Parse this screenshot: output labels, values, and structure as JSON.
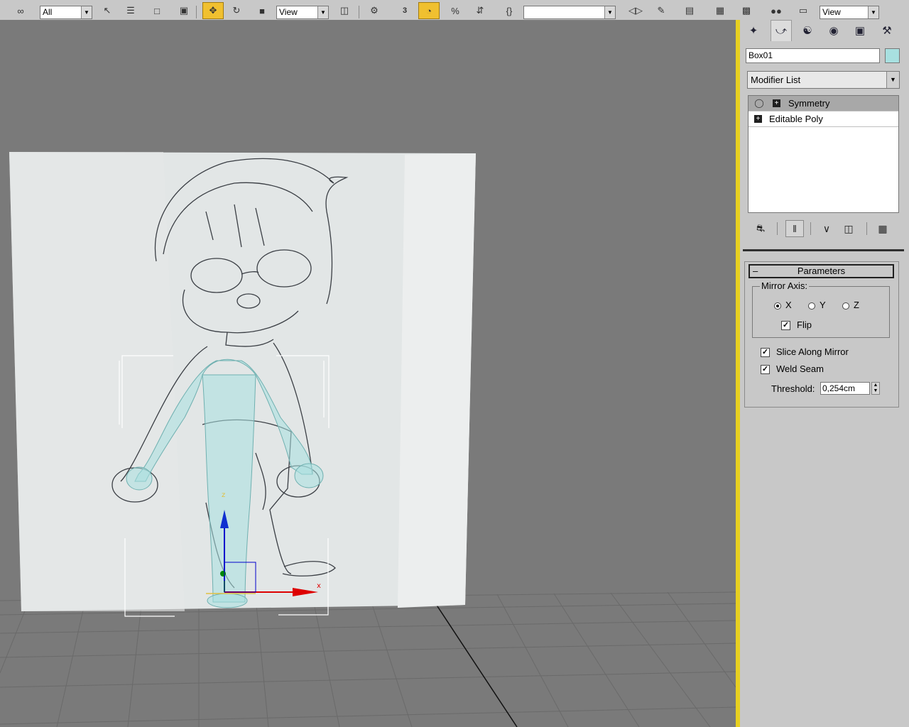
{
  "toolbar": {
    "selection_filter": "All",
    "ref_coord_system": "View",
    "named_selection": "",
    "ref_coord_system_right": "View",
    "angle_snap_label": "3"
  },
  "command_panel": {
    "tabs": [
      "create-icon",
      "modify-icon",
      "hierarchy-icon",
      "motion-icon",
      "display-icon",
      "utilities-icon"
    ],
    "object_name": "Box01",
    "object_color": "#a8e0e0",
    "modifier_list": "Modifier List",
    "stack": [
      {
        "label": "Symmetry",
        "selected": true
      },
      {
        "label": "Editable Poly",
        "selected": false
      }
    ],
    "parameters": {
      "title": "Parameters",
      "collapse_symbol": "–",
      "mirror_axis_label": "Mirror Axis:",
      "axes": [
        "X",
        "Y",
        "Z"
      ],
      "selected_axis": "X",
      "flip_label": "Flip",
      "flip_checked": true,
      "slice_label": "Slice Along Mirror",
      "slice_checked": true,
      "weld_label": "Weld Seam",
      "weld_checked": true,
      "threshold_label": "Threshold:",
      "threshold_value": "0,254cm"
    }
  },
  "colors": {
    "viewport_bg": "#7a7a7a",
    "active_viewport_border": "#e8d020",
    "active_button": "#f0c030",
    "mesh_tint": "#a8e0e0"
  }
}
